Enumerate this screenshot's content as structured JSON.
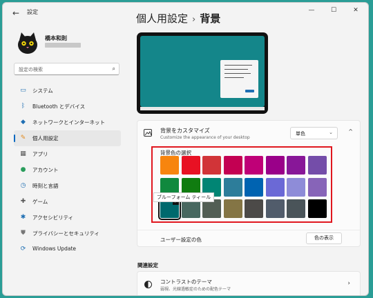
{
  "window": {
    "app_title": "設定",
    "back_glyph": "←",
    "minimize_glyph": "—",
    "maximize_glyph": "☐",
    "close_glyph": "✕"
  },
  "profile": {
    "name": "橋本和則"
  },
  "search": {
    "placeholder": "設定の検索",
    "icon": "search-icon"
  },
  "sidebar": {
    "items": [
      {
        "label": "システム",
        "icon": "monitor-icon",
        "color": "#1f6fb3",
        "active": false
      },
      {
        "label": "Bluetooth とデバイス",
        "icon": "bluetooth-icon",
        "color": "#1f6fb3",
        "active": false
      },
      {
        "label": "ネットワークとインターネット",
        "icon": "wifi-icon",
        "color": "#1f6fb3",
        "active": false
      },
      {
        "label": "個人用設定",
        "icon": "brush-icon",
        "color": "#e28a1d",
        "active": true
      },
      {
        "label": "アプリ",
        "icon": "apps-icon",
        "color": "#555555",
        "active": false
      },
      {
        "label": "アカウント",
        "icon": "person-icon",
        "color": "#2a9d5c",
        "active": false
      },
      {
        "label": "時刻と言語",
        "icon": "globe-clock-icon",
        "color": "#1f6fb3",
        "active": false
      },
      {
        "label": "ゲーム",
        "icon": "gamepad-icon",
        "color": "#555555",
        "active": false
      },
      {
        "label": "アクセシビリティ",
        "icon": "accessibility-icon",
        "color": "#1f6fb3",
        "active": false
      },
      {
        "label": "プライバシーとセキュリティ",
        "icon": "shield-icon",
        "color": "#777777",
        "active": false
      },
      {
        "label": "Windows Update",
        "icon": "update-icon",
        "color": "#1f6fb3",
        "active": false
      }
    ]
  },
  "breadcrumb": {
    "parent": "個人用設定",
    "separator": "›",
    "current": "背景"
  },
  "background": {
    "title": "背景をカスタマイズ",
    "subtitle": "Customize the appearance of your desktop",
    "mode_value": "単色",
    "mode_chevron": "⌄",
    "collapse_glyph": "^",
    "color_section_title": "背景色の選択",
    "colors": [
      "#f7850e",
      "#e81123",
      "#d13438",
      "#c30052",
      "#bf0077",
      "#9a0089",
      "#881798",
      "#744da9",
      "#10893e",
      "#107c10",
      "#018574",
      "#2d7d9a",
      "#0063b1",
      "#6b69d6",
      "#8e8cd8",
      "#8764b8",
      "#00696d",
      "#486860",
      "#525e54",
      "#847545",
      "#4c4a48",
      "#515c6b",
      "#4a5459",
      "#000000"
    ],
    "selected_index": 16,
    "selected_check": "✓",
    "tooltip": "ブルーフォーム ティール",
    "custom_label": "ユーザー設定の色",
    "custom_button": "色の表示"
  },
  "related": {
    "title": "関連設定",
    "contrast_title": "コントラストのテーマ",
    "contrast_subtitle": "弱視、光線過敏症のための配色テーマ",
    "chevron": "›"
  }
}
